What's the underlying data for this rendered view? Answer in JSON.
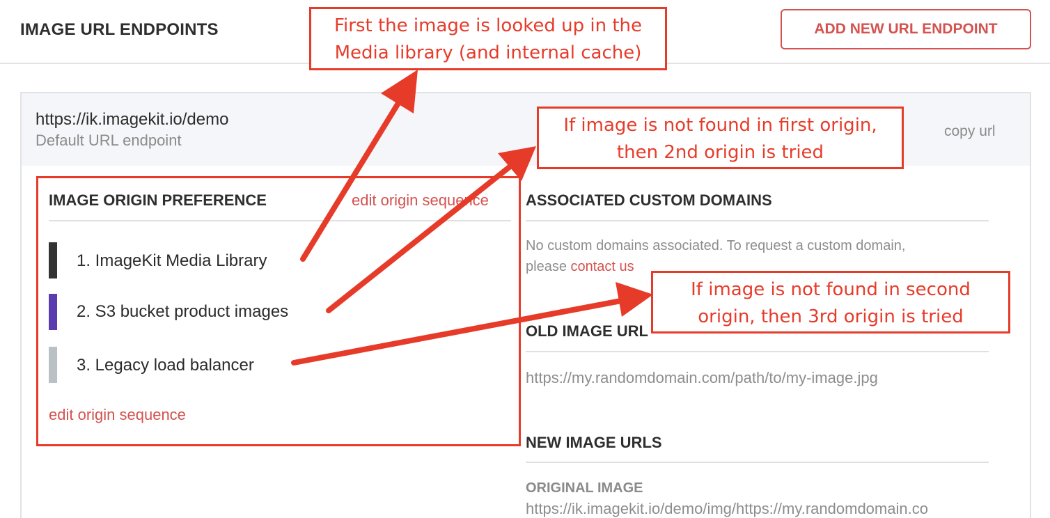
{
  "header": {
    "title": "IMAGE URL ENDPOINTS",
    "add_button_label": "ADD NEW URL ENDPOINT"
  },
  "endpoint": {
    "url": "https://ik.imagekit.io/demo",
    "subtitle": "Default URL endpoint",
    "copy_label": "copy url"
  },
  "origin_preference": {
    "title": "IMAGE ORIGIN PREFERENCE",
    "edit_link_top": "edit origin sequence",
    "edit_link_bottom": "edit origin sequence",
    "origins": [
      {
        "label": "1. ImageKit Media Library",
        "color": "#333333"
      },
      {
        "label": "2. S3 bucket product images",
        "color": "#5b3bb0"
      },
      {
        "label": "3. Legacy load balancer",
        "color": "#b9c0c6"
      }
    ]
  },
  "custom_domains": {
    "title": "ASSOCIATED CUSTOM DOMAINS",
    "text_line1": "No custom domains associated. To request a custom domain,",
    "text_line2_prefix": "please ",
    "contact_link": "contact us"
  },
  "old_image_url": {
    "title": "OLD IMAGE URL",
    "value": "https://my.randomdomain.com/path/to/my-image.jpg"
  },
  "new_image_urls": {
    "title": "NEW IMAGE URLS",
    "original_label": "ORIGINAL IMAGE",
    "original_value": "https://ik.imagekit.io/demo/img/https://my.randomdomain.co"
  },
  "annotations": {
    "first": [
      "First the image is looked up in the",
      "Media library (and internal cache)"
    ],
    "second": [
      "If image is not found in first origin,",
      "then 2nd origin is tried"
    ],
    "third": [
      "If image is not found in second",
      "origin, then 3rd origin is tried"
    ]
  },
  "colors": {
    "accent": "#d4524f",
    "annotation": "#e73b2a"
  }
}
